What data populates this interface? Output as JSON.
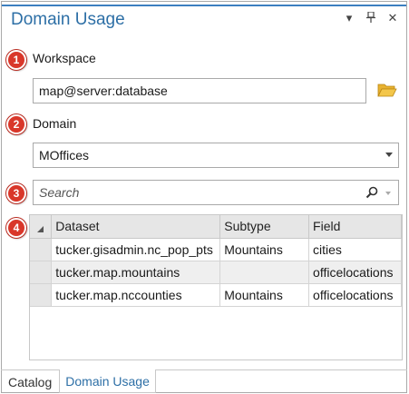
{
  "pane": {
    "title": "Domain Usage",
    "menu_glyph": "▾",
    "pin_glyph": "⊥",
    "close_glyph": "✕"
  },
  "callouts": [
    "1",
    "2",
    "3",
    "4"
  ],
  "workspace": {
    "label": "Workspace",
    "value": "map@server:database"
  },
  "domain": {
    "label": "Domain",
    "selected": "MOffices"
  },
  "search": {
    "placeholder": "Search"
  },
  "table": {
    "columns": [
      "Dataset",
      "Subtype",
      "Field"
    ],
    "rows": [
      [
        "tucker.gisadmin.nc_pop_pts",
        "Mountains",
        "cities"
      ],
      [
        "tucker.map.mountains",
        "",
        "officelocations"
      ],
      [
        "tucker.map.nccounties",
        "Mountains",
        "officelocations"
      ]
    ]
  },
  "tabs": [
    {
      "label": "Catalog",
      "active": false
    },
    {
      "label": "Domain Usage",
      "active": true
    }
  ],
  "colors": {
    "accent": "#2d6fa6",
    "callout": "#d9372a",
    "folder": "#e8b230"
  },
  "icons": [
    "folder-icon",
    "search-icon",
    "sort-corner-icon"
  ]
}
